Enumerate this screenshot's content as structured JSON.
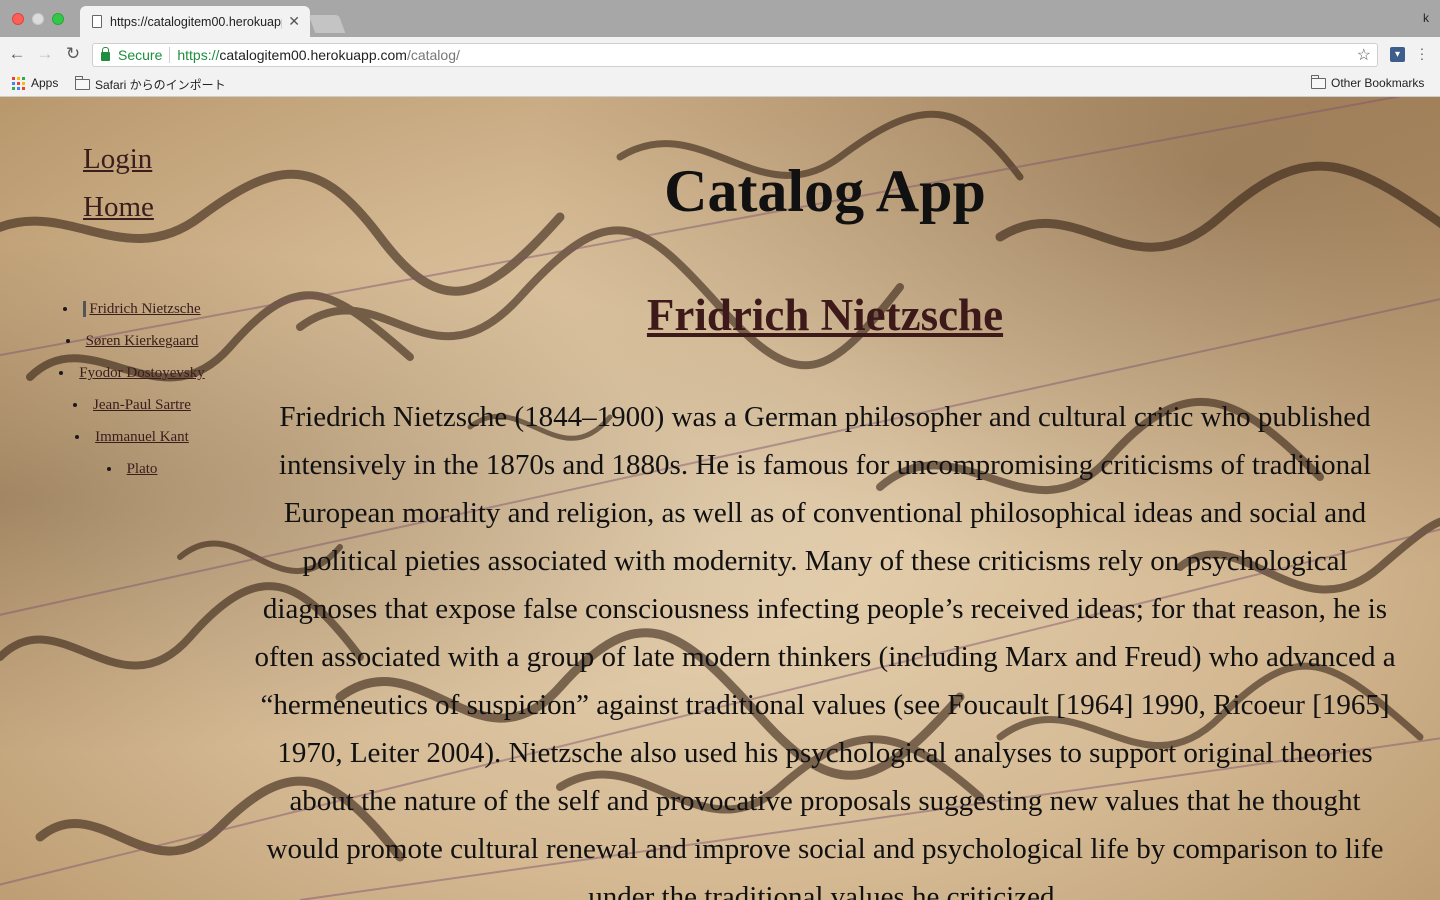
{
  "browser": {
    "tab_title": "https://catalogitem00.herokuapp.com/catalog/",
    "profile_letter": "k",
    "secure_label": "Secure",
    "url_scheme": "https://",
    "url_host": "catalogitem00.herokuapp.com",
    "url_path": "/catalog/",
    "bookmarks": {
      "apps": "Apps",
      "safari": "Safari からのインポート",
      "other": "Other Bookmarks"
    },
    "colors": {
      "secure_green": "#1e8e3e",
      "tabbar": "#a7a7a7",
      "toolbar": "#f2f2f2"
    }
  },
  "page": {
    "nav": {
      "login": "Login",
      "home": "Home"
    },
    "title": "Catalog App",
    "philosophers": [
      "Fridrich Nietzsche",
      "Søren Kierkegaard",
      "Fyodor Dostoyevsky",
      "Jean-Paul Sartre",
      "Immanuel Kant",
      "Plato"
    ],
    "selected": {
      "name": "Fridrich Nietzsche",
      "description": "Friedrich Nietzsche (1844–1900) was a German philosopher and cultural critic who published intensively in the 1870s and 1880s. He is famous for uncompromising criticisms of traditional European morality and religion, as well as of conventional philosophical ideas and social and political pieties associated with modernity. Many of these criticisms rely on psychological diagnoses that expose false consciousness infecting people’s received ideas; for that reason, he is often associated with a group of late modern thinkers (including Marx and Freud) who advanced a “hermeneutics of suspicion” against traditional values (see Foucault [1964] 1990, Ricoeur [1965] 1970, Leiter 2004). Nietzsche also used his psychological analyses to support original theories about the nature of the self and provocative proposals suggesting new values that he thought would promote cultural renewal and improve social and psychological life by comparison to life under the traditional values he criticized."
    }
  }
}
